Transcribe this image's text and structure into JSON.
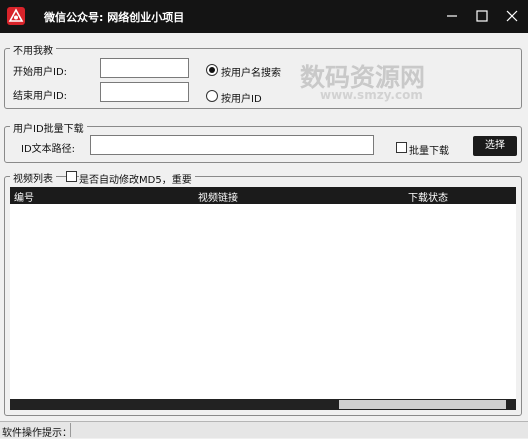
{
  "window": {
    "title": "微信公众号: 网络创业小项目",
    "buttons": [
      "minimize",
      "maximize",
      "close"
    ]
  },
  "uid_range": {
    "legend": "不用我教",
    "start_label": "开始用户ID:",
    "start_value": "",
    "end_label": "结束用户ID:",
    "end_value": "",
    "options": [
      {
        "label": "按用户名搜索",
        "selected": true
      },
      {
        "label": "按用户ID",
        "selected": false
      }
    ]
  },
  "batch": {
    "legend": "用户ID批量下载",
    "path_label": "ID文本路径:",
    "path_value": "",
    "batch_label": "批量下载",
    "batch_checked": false,
    "choose_button": "选择"
  },
  "videos": {
    "legend": "视频列表",
    "auto_md5_label": "是否自动修改MD5，重要",
    "auto_md5_checked": false,
    "columns": [
      "编号",
      "视频链接",
      "下载状态"
    ],
    "rows": []
  },
  "status": {
    "label": "软件操作提示："
  },
  "watermark": {
    "text": "数码资源网",
    "url": "www.smzy.com"
  },
  "colors": {
    "titlebar": "#141414",
    "table_header": "#1b1b1b",
    "app_icon": "#d8232a",
    "background": "#f0f0f0"
  },
  "icons": [
    "app-logo-icon",
    "minimize-icon",
    "maximize-icon",
    "close-icon"
  ]
}
